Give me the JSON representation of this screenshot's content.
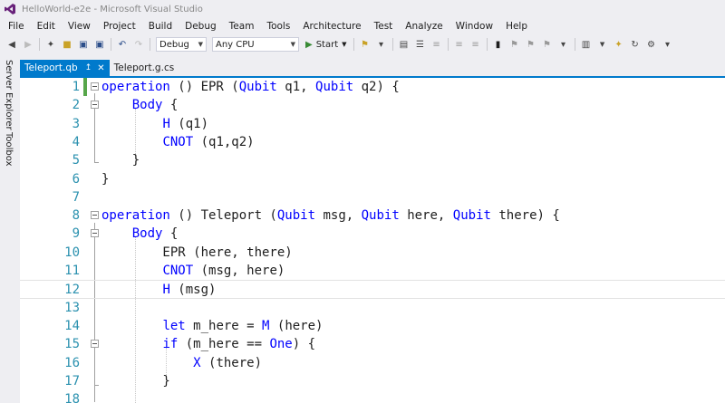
{
  "window": {
    "title": "HelloWorld-e2e - Microsoft Visual Studio"
  },
  "menu": [
    "File",
    "Edit",
    "View",
    "Project",
    "Build",
    "Debug",
    "Team",
    "Tools",
    "Architecture",
    "Test",
    "Analyze",
    "Window",
    "Help"
  ],
  "toolbar": {
    "config": "Debug",
    "platform": "Any CPU",
    "start_label": "Start"
  },
  "side_tabs": [
    "Server Explorer",
    "Toolbox"
  ],
  "tabs": [
    {
      "label": "Teleport.qb",
      "active": true
    },
    {
      "label": "Teleport.g.cs",
      "active": false
    }
  ],
  "editor": {
    "lines": [
      {
        "n": "1",
        "tokens": [
          {
            "t": "operation",
            "kw": true
          },
          {
            "t": " () EPR ("
          },
          {
            "t": "Qubit",
            "kw": true
          },
          {
            "t": " q1, "
          },
          {
            "t": "Qubit",
            "kw": true
          },
          {
            "t": " q2) {"
          }
        ]
      },
      {
        "n": "2",
        "tokens": [
          {
            "t": "    "
          },
          {
            "t": "Body",
            "kw": true
          },
          {
            "t": " {"
          }
        ]
      },
      {
        "n": "3",
        "tokens": [
          {
            "t": "        "
          },
          {
            "t": "H",
            "kw": true
          },
          {
            "t": " (q1)"
          }
        ]
      },
      {
        "n": "4",
        "tokens": [
          {
            "t": "        "
          },
          {
            "t": "CNOT",
            "kw": true
          },
          {
            "t": " (q1,q2)"
          }
        ]
      },
      {
        "n": "5",
        "tokens": [
          {
            "t": "    }"
          }
        ]
      },
      {
        "n": "6",
        "tokens": [
          {
            "t": "}"
          }
        ]
      },
      {
        "n": "7",
        "tokens": []
      },
      {
        "n": "8",
        "tokens": [
          {
            "t": "operation",
            "kw": true
          },
          {
            "t": " () Teleport ("
          },
          {
            "t": "Qubit",
            "kw": true
          },
          {
            "t": " msg, "
          },
          {
            "t": "Qubit",
            "kw": true
          },
          {
            "t": " here, "
          },
          {
            "t": "Qubit",
            "kw": true
          },
          {
            "t": " there) {"
          }
        ]
      },
      {
        "n": "9",
        "tokens": [
          {
            "t": "    "
          },
          {
            "t": "Body",
            "kw": true
          },
          {
            "t": " {"
          }
        ]
      },
      {
        "n": "10",
        "tokens": [
          {
            "t": "        EPR (here, there)"
          }
        ]
      },
      {
        "n": "11",
        "tokens": [
          {
            "t": "        "
          },
          {
            "t": "CNOT",
            "kw": true
          },
          {
            "t": " (msg, here)"
          }
        ]
      },
      {
        "n": "12",
        "tokens": [
          {
            "t": "        "
          },
          {
            "t": "H",
            "kw": true
          },
          {
            "t": " (msg)"
          }
        ]
      },
      {
        "n": "13",
        "tokens": []
      },
      {
        "n": "14",
        "tokens": [
          {
            "t": "        "
          },
          {
            "t": "let",
            "kw": true
          },
          {
            "t": " m_here = "
          },
          {
            "t": "M",
            "kw": true
          },
          {
            "t": " (here)"
          }
        ]
      },
      {
        "n": "15",
        "tokens": [
          {
            "t": "        "
          },
          {
            "t": "if",
            "kw": true
          },
          {
            "t": " (m_here == "
          },
          {
            "t": "One",
            "kw": true
          },
          {
            "t": ") {"
          }
        ]
      },
      {
        "n": "16",
        "tokens": [
          {
            "t": "            "
          },
          {
            "t": "X",
            "kw": true
          },
          {
            "t": " (there)"
          }
        ]
      },
      {
        "n": "17",
        "tokens": [
          {
            "t": "        }"
          }
        ]
      },
      {
        "n": "18",
        "tokens": []
      }
    ]
  }
}
